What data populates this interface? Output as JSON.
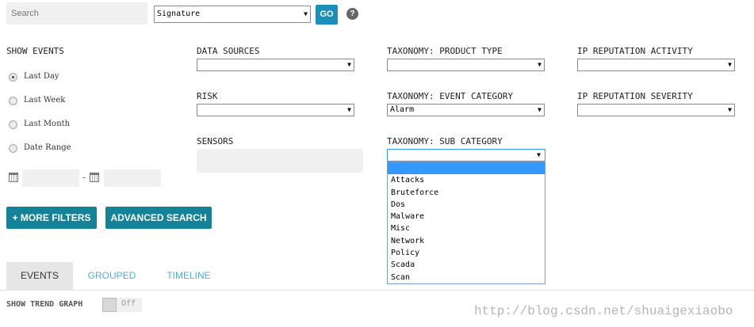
{
  "search": {
    "placeholder": "Search",
    "mode_selected": "Signature",
    "go_label": "GO",
    "help_icon": "question-icon"
  },
  "show_events": {
    "label": "SHOW EVENTS",
    "options": [
      "Last Day",
      "Last Week",
      "Last Month",
      "Date Range"
    ],
    "selected": "Last Day",
    "date_separator": "-"
  },
  "filters": {
    "data_sources": {
      "label": "DATA SOURCES",
      "value": ""
    },
    "risk": {
      "label": "RISK",
      "value": ""
    },
    "sensors": {
      "label": "SENSORS"
    },
    "product_type": {
      "label": "TAXONOMY: PRODUCT TYPE",
      "value": ""
    },
    "event_category": {
      "label": "TAXONOMY: EVENT CATEGORY",
      "value": "Alarm"
    },
    "sub_category": {
      "label": "TAXONOMY: SUB CATEGORY",
      "value": "",
      "options": [
        "",
        "Attacks",
        "Bruteforce",
        "Dos",
        "Malware",
        "Misc",
        "Network",
        "Policy",
        "Scada",
        "Scan"
      ],
      "highlighted_index": 0
    },
    "ip_rep_activity": {
      "label": "IP REPUTATION ACTIVITY",
      "value": ""
    },
    "ip_rep_severity": {
      "label": "IP REPUTATION SEVERITY",
      "value": ""
    }
  },
  "buttons": {
    "more_filters": "+ MORE FILTERS",
    "advanced_search": "ADVANCED SEARCH"
  },
  "tabs": [
    {
      "label": "EVENTS",
      "active": true
    },
    {
      "label": "GROUPED",
      "active": false
    },
    {
      "label": "TIMELINE",
      "active": false
    }
  ],
  "trend_graph": {
    "label": "SHOW TREND GRAPH",
    "state": "Off"
  },
  "watermark": "http://blog.csdn.net/shuaigexiaobo",
  "colors": {
    "accent": "#14839a",
    "go": "#1a8fb8",
    "tab_inactive": "#4fb0cf",
    "highlight": "#3399ff"
  }
}
